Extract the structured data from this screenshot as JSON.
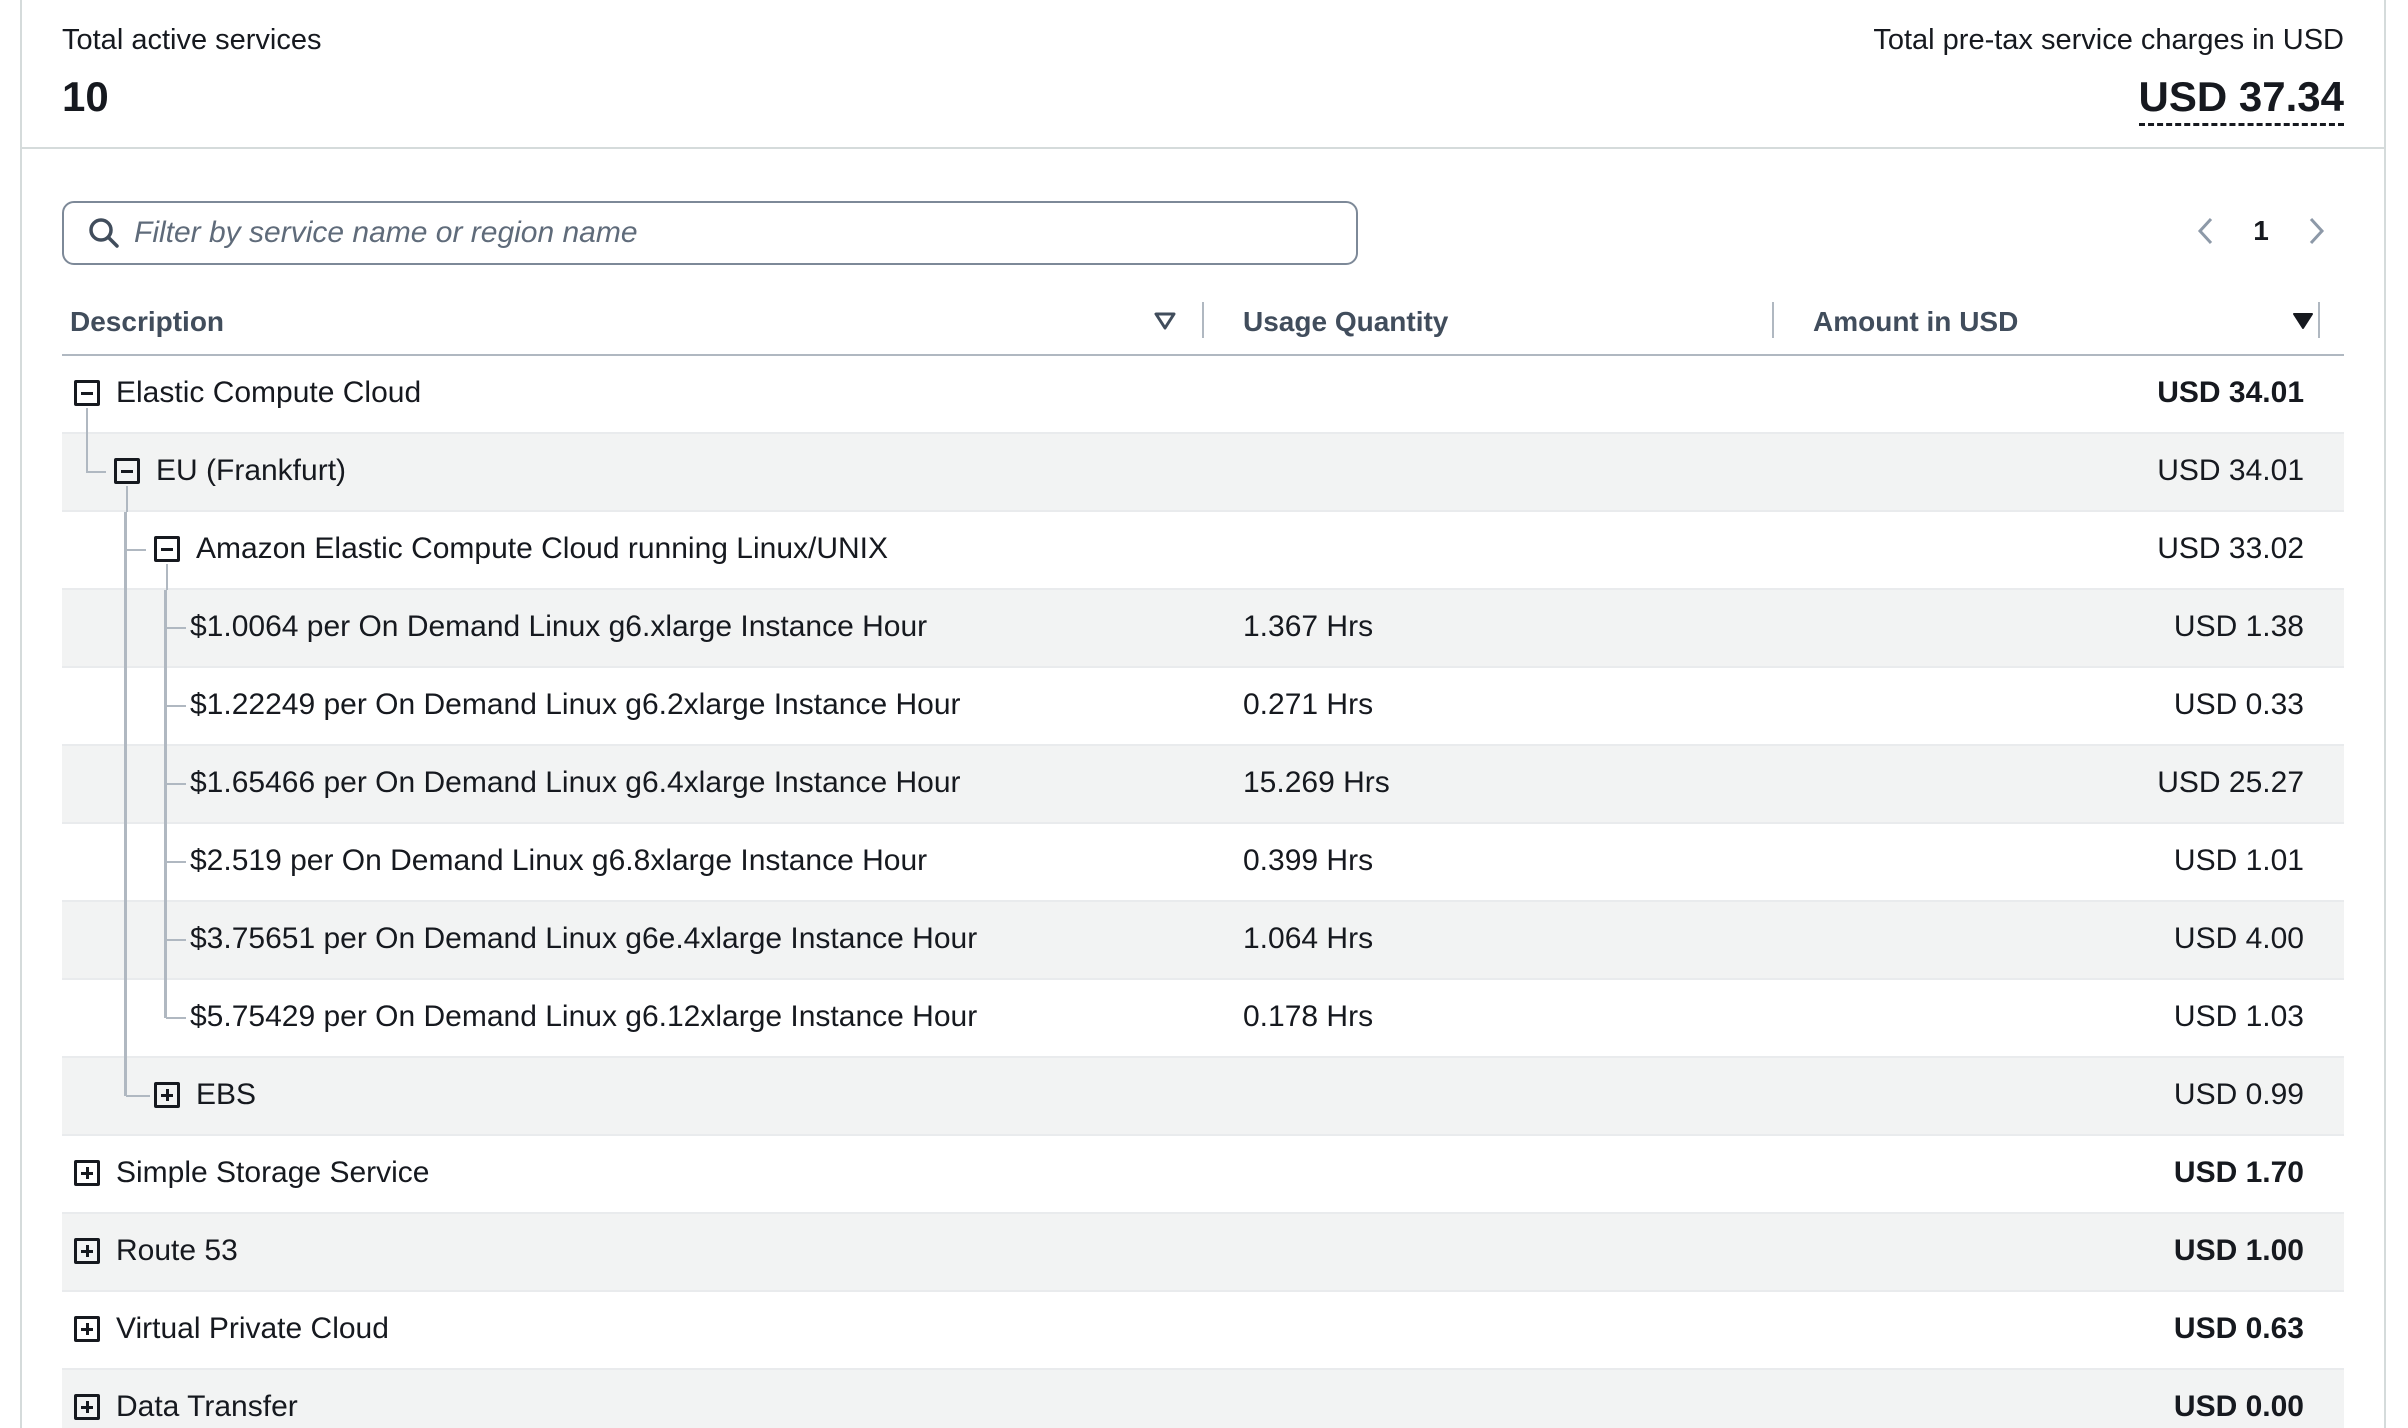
{
  "summary": {
    "active_services_label": "Total active services",
    "active_services_count": "10",
    "charges_label": "Total pre-tax service charges in USD",
    "charges_total": "USD 37.34"
  },
  "search": {
    "placeholder": "Filter by service name or region name",
    "value": ""
  },
  "pagination": {
    "current_page": "1"
  },
  "table": {
    "columns": {
      "description": "Description",
      "usage_quantity": "Usage Quantity",
      "amount": "Amount in USD"
    },
    "rows": [
      {
        "label": "Elastic Compute Cloud",
        "qty": "",
        "amount": "USD 34.01"
      },
      {
        "label": "EU (Frankfurt)",
        "qty": "",
        "amount": "USD 34.01"
      },
      {
        "label": "Amazon Elastic Compute Cloud running Linux/UNIX",
        "qty": "",
        "amount": "USD 33.02"
      },
      {
        "label": "$1.0064 per On Demand Linux g6.xlarge Instance Hour",
        "qty": "1.367 Hrs",
        "amount": "USD 1.38"
      },
      {
        "label": "$1.22249 per On Demand Linux g6.2xlarge Instance Hour",
        "qty": "0.271 Hrs",
        "amount": "USD 0.33"
      },
      {
        "label": "$1.65466 per On Demand Linux g6.4xlarge Instance Hour",
        "qty": "15.269 Hrs",
        "amount": "USD 25.27"
      },
      {
        "label": "$2.519 per On Demand Linux g6.8xlarge Instance Hour",
        "qty": "0.399 Hrs",
        "amount": "USD 1.01"
      },
      {
        "label": "$3.75651 per On Demand Linux g6e.4xlarge Instance Hour",
        "qty": "1.064 Hrs",
        "amount": "USD 4.00"
      },
      {
        "label": "$5.75429 per On Demand Linux g6.12xlarge Instance Hour",
        "qty": "0.178 Hrs",
        "amount": "USD 1.03"
      },
      {
        "label": "EBS",
        "qty": "",
        "amount": "USD 0.99"
      },
      {
        "label": "Simple Storage Service",
        "qty": "",
        "amount": "USD 1.70"
      },
      {
        "label": "Route 53",
        "qty": "",
        "amount": "USD 1.00"
      },
      {
        "label": "Virtual Private Cloud",
        "qty": "",
        "amount": "USD 0.63"
      },
      {
        "label": "Data Transfer",
        "qty": "",
        "amount": "USD 0.00"
      }
    ]
  }
}
